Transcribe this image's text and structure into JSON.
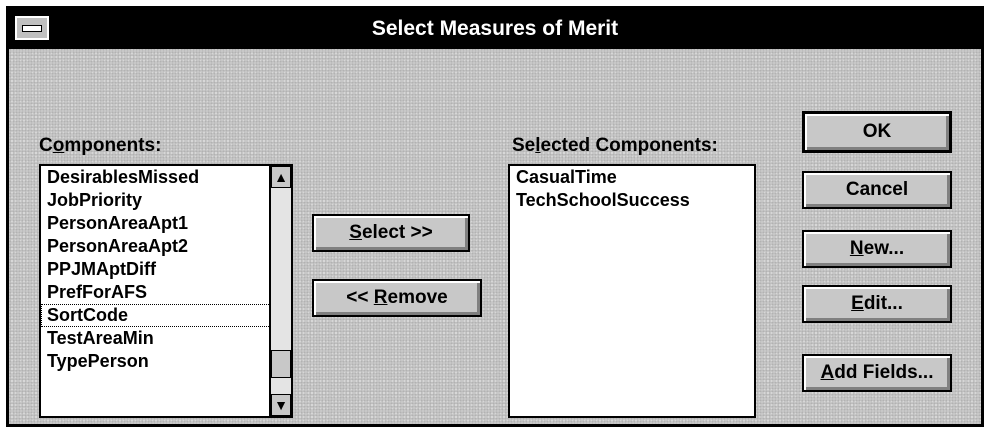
{
  "window": {
    "title": "Select Measures of Merit"
  },
  "components": {
    "label_mnemonic": "o",
    "label_pre": "C",
    "label_post": "mponents:",
    "items": [
      "DesirablesMissed",
      "JobPriority",
      "PersonAreaApt1",
      "PersonAreaApt2",
      "PPJMAptDiff",
      "PrefForAFS",
      "SortCode",
      "TestAreaMin",
      "TypePerson"
    ],
    "focused_item": "SortCode"
  },
  "selected": {
    "label_pre": "Se",
    "label_mnemonic": "l",
    "label_post": "ected Components:",
    "items": [
      "CasualTime",
      "TechSchoolSuccess"
    ]
  },
  "buttons": {
    "select": {
      "mn": "S",
      "rest": "elect >>"
    },
    "remove": {
      "pre": "<< ",
      "mn": "R",
      "rest": "emove"
    },
    "ok": "OK",
    "cancel": "Cancel",
    "new": {
      "mn": "N",
      "rest": "ew..."
    },
    "edit": {
      "mn": "E",
      "rest": "dit..."
    },
    "add_fields": {
      "mn": "A",
      "rest": "dd Fields..."
    }
  },
  "icons": {
    "scroll_up": "arrow-up-icon",
    "scroll_down": "arrow-down-icon",
    "system_menu": "system-menu-icon"
  }
}
